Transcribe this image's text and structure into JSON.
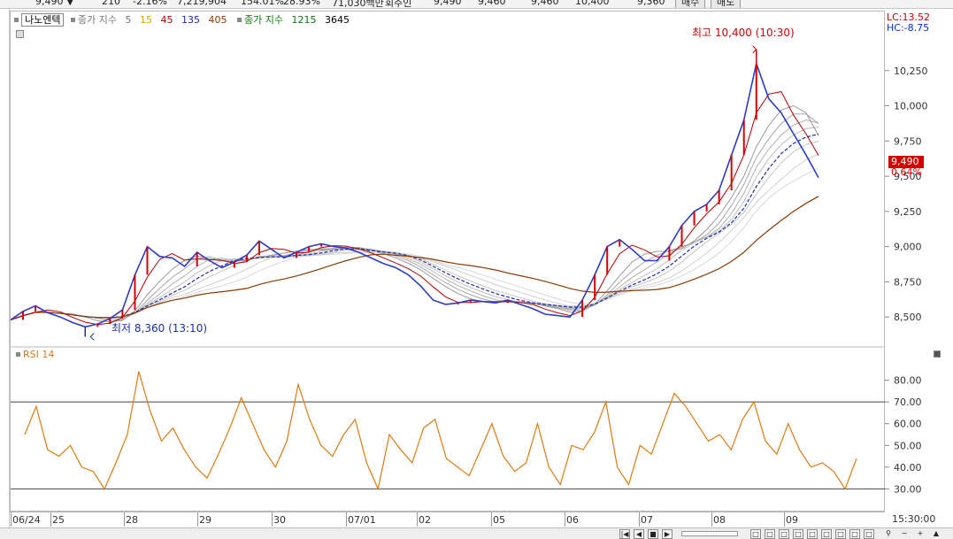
{
  "legend": {
    "name": "나노엔텍",
    "label1": "종가 지수",
    "p1": "5",
    "p2": "15",
    "p3": "45",
    "p4": "135",
    "p5": "405",
    "label2": "종가 지수",
    "p6": "1215",
    "p7": "3645"
  },
  "right_panel": {
    "lc": "LC:13.52",
    "hc": "HC:-8.75",
    "current_price": "9,490",
    "change_pct": "0.64%",
    "time": "15:30:00"
  },
  "annotations": {
    "high": "최고 10,400 (10:30)",
    "low": "최저 8,360 (13:10)"
  },
  "rsi": {
    "label": "RSI 14"
  },
  "chart_data": [
    {
      "type": "line",
      "title": "",
      "ylim": [
        8300,
        10500
      ],
      "yticks": [
        "10,250",
        "10,000",
        "9,750",
        "9,500",
        "9,250",
        "9,000",
        "8,750",
        "8,500"
      ],
      "ytick_values": [
        10250,
        10000,
        9750,
        9500,
        9250,
        9000,
        8750,
        8500
      ],
      "x": [
        "06/24",
        "25",
        "28",
        "29",
        "30",
        "07/01",
        "02",
        "05",
        "06",
        "07",
        "08",
        "09"
      ],
      "series": [
        {
          "values": [
            8480,
            8540,
            8580,
            8530,
            8500,
            8460,
            8430,
            8450,
            8490,
            8550,
            8800,
            9000,
            8930,
            8920,
            8860,
            8960,
            8900,
            8850,
            8890,
            8940,
            9040,
            8980,
            8920,
            8960,
            9000,
            9020,
            9000,
            8990,
            8960,
            8920,
            8880,
            8850,
            8800,
            8720,
            8620,
            8590,
            8600,
            8620,
            8610,
            8600,
            8620,
            8590,
            8560,
            8520,
            8510,
            8500,
            8620,
            8800,
            9000,
            9050,
            8980,
            8900,
            8900,
            9000,
            9150,
            9250,
            9300,
            9400,
            9650,
            9900,
            10300,
            10050,
            9950,
            9800,
            9650,
            9490
          ]
        }
      ],
      "high": 10400,
      "low": 8360
    },
    {
      "type": "line",
      "title": "",
      "ylim": [
        22,
        88
      ],
      "yticks": [
        "80.00",
        "70.00",
        "60.00",
        "50.00",
        "40.00",
        "30.00"
      ],
      "ytick_values": [
        80,
        70,
        60,
        50,
        40,
        30
      ],
      "reference_lines": [
        70,
        30
      ],
      "series": [
        {
          "values": [
            55,
            68,
            48,
            45,
            50,
            40,
            38,
            30,
            42,
            55,
            84,
            66,
            52,
            58,
            48,
            40,
            35,
            46,
            58,
            72,
            60,
            48,
            40,
            52,
            78,
            62,
            50,
            45,
            55,
            62,
            42,
            30,
            55,
            48,
            42,
            58,
            62,
            44,
            40,
            36,
            48,
            60,
            45,
            38,
            42,
            60,
            40,
            32,
            50,
            48,
            56,
            70,
            40,
            32,
            50,
            46,
            60,
            74,
            68,
            60,
            52,
            55,
            48,
            62,
            70,
            52,
            46,
            60,
            48,
            40,
            42,
            38,
            30,
            44
          ]
        }
      ]
    }
  ]
}
